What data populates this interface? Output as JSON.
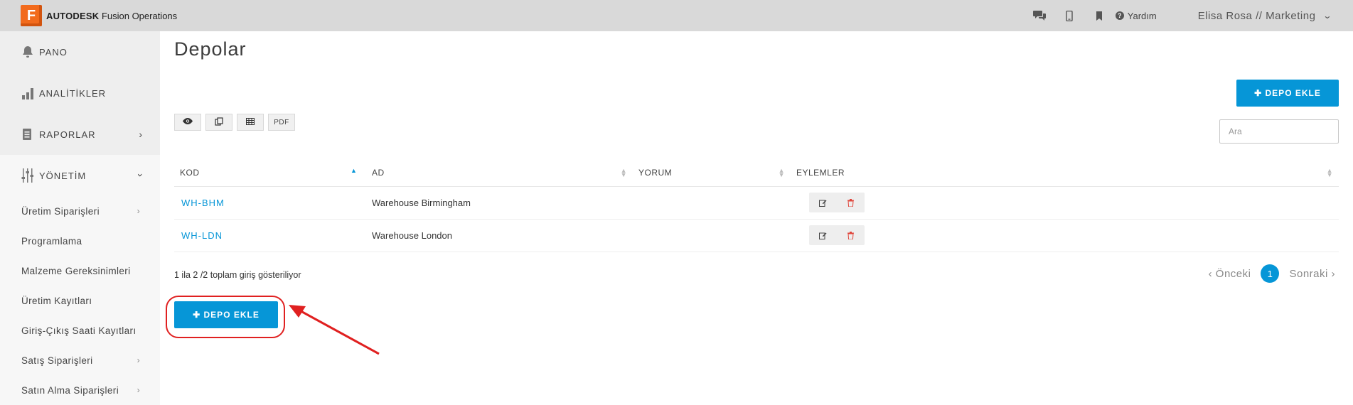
{
  "brand": {
    "logo_letter": "F",
    "name_bold": "AUTODESK",
    "name_rest": "Fusion Operations"
  },
  "topbar": {
    "icons": [
      "chat-icon",
      "mobile-icon",
      "bookmark-icon"
    ],
    "help_label": "Yardım",
    "user_label": "Elisa Rosa // Marketing"
  },
  "sidebar": {
    "items": [
      {
        "label": "PANO",
        "icon": "bell-icon"
      },
      {
        "label": "ANALİTİKLER",
        "icon": "bar-chart-icon"
      },
      {
        "label": "RAPORLAR",
        "icon": "report-icon"
      },
      {
        "label": "YÖNETİM",
        "icon": "sliders-icon"
      }
    ],
    "sub_items": [
      {
        "label": "Üretim Siparişleri",
        "has_arrow": true
      },
      {
        "label": "Programlama",
        "has_arrow": false
      },
      {
        "label": "Malzeme Gereksinimleri",
        "has_arrow": false
      },
      {
        "label": "Üretim Kayıtları",
        "has_arrow": false
      },
      {
        "label": "Giriş-Çıkış Saati Kayıtları",
        "has_arrow": false
      },
      {
        "label": "Satış Siparişleri",
        "has_arrow": true
      },
      {
        "label": "Satın Alma Siparişleri",
        "has_arrow": true
      }
    ]
  },
  "main": {
    "title": "Depolar",
    "add_button_label": "✚ DEPO EKLE",
    "tools": {
      "pdf_label": "PDF"
    },
    "search_placeholder": "Ara",
    "table": {
      "headers": [
        "KOD",
        "AD",
        "YORUM",
        "EYLEMLER"
      ],
      "rows": [
        {
          "code": "WH-BHM",
          "name": "Warehouse Birmingham",
          "comment": ""
        },
        {
          "code": "WH-LDN",
          "name": "Warehouse London",
          "comment": ""
        }
      ]
    },
    "info_text": "1 ila 2 /2 toplam giriş gösteriliyor",
    "pager": {
      "prev": "‹ Önceki",
      "current": "1",
      "next": "Sonraki ›"
    }
  },
  "colors": {
    "accent": "#0696d7",
    "highlight": "#e02020",
    "brand": "#f26b1d"
  }
}
